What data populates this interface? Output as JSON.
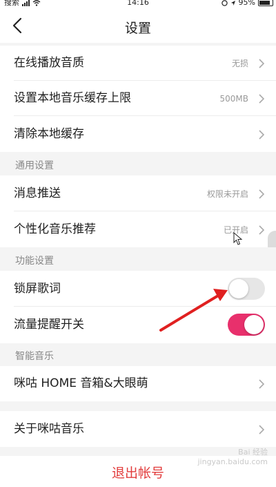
{
  "status_bar": {
    "carrier": "搜索",
    "time": "14:16",
    "battery": "95%"
  },
  "header": {
    "title": "设置"
  },
  "rows": {
    "quality": {
      "label": "在线播放音质",
      "value": "无损"
    },
    "cache_limit": {
      "label": "设置本地音乐缓存上限",
      "value": "500MB"
    },
    "clear_cache": {
      "label": "清除本地缓存"
    },
    "push": {
      "label": "消息推送",
      "value": "权限未开启"
    },
    "recommend": {
      "label": "个性化音乐推荐",
      "value": "已开启"
    },
    "lyrics": {
      "label": "锁屏歌词",
      "toggle_on": false
    },
    "traffic": {
      "label": "流量提醒开关",
      "toggle_on": true
    },
    "home": {
      "label": "咪咕 HOME 音箱&大眼萌"
    },
    "about": {
      "label": "关于咪咕音乐"
    }
  },
  "sections": {
    "general": "通用设置",
    "features": "功能设置",
    "smart": "智能音乐"
  },
  "logout": {
    "label": "退出帐号"
  },
  "watermark": {
    "line1": "Bai 经验",
    "line2": "jingyan.baidu.com"
  },
  "icons": [
    "back-icon",
    "chevron-right-icon",
    "wifi-icon",
    "signal-icon",
    "battery-icon"
  ],
  "colors": {
    "accent": "#e8306c",
    "logout": "#e23d3d",
    "annotation_arrow": "#e02020"
  }
}
